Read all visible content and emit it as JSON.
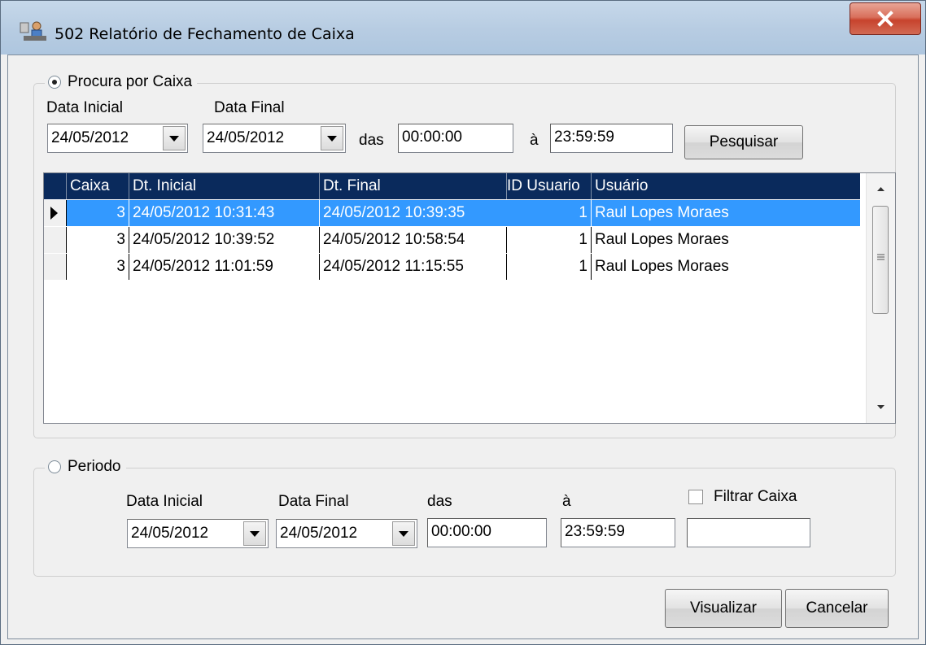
{
  "window": {
    "title": "502 Relatório de Fechamento de Caixa"
  },
  "grupo_caixa": {
    "legend": "Procura por Caixa",
    "data_inicial_label": "Data Inicial",
    "data_final_label": "Data Final",
    "data_inicial": "24/05/2012",
    "data_final": "24/05/2012",
    "das_label": "das",
    "hora_inicial": "00:00:00",
    "a_label": "à",
    "hora_final": "23:59:59",
    "pesquisar": "Pesquisar"
  },
  "grid": {
    "columns": [
      "Caixa",
      "Dt. Inicial",
      "Dt. Final",
      "ID Usuario",
      "Usuário"
    ],
    "rows": [
      [
        "3",
        "24/05/2012 10:31:43",
        "24/05/2012 10:39:35",
        "1",
        "Raul Lopes Moraes"
      ],
      [
        "3",
        "24/05/2012 10:39:52",
        "24/05/2012 10:58:54",
        "1",
        "Raul Lopes Moraes"
      ],
      [
        "3",
        "24/05/2012 11:01:59",
        "24/05/2012 11:15:55",
        "1",
        "Raul Lopes Moraes"
      ]
    ]
  },
  "grupo_periodo": {
    "legend": "Periodo",
    "data_inicial_label": "Data Inicial",
    "data_final_label": "Data Final",
    "das_label": "das",
    "a_label": "à",
    "filtrar_caixa_label": "Filtrar Caixa",
    "data_inicial": "24/05/2012",
    "data_final": "24/05/2012",
    "hora_inicial": "00:00:00",
    "hora_final": "23:59:59",
    "caixa": ""
  },
  "buttons": {
    "visualizar": "Visualizar",
    "cancelar": "Cancelar"
  },
  "colors": {
    "selection": "#3399ff",
    "header": "#0a2a5c"
  }
}
